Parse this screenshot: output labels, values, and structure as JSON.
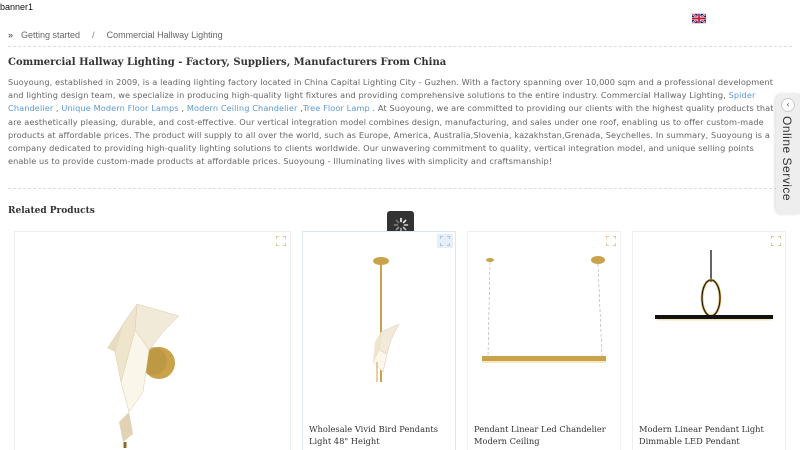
{
  "banner": {
    "label": "banner1"
  },
  "header": {
    "flag_icon": "uk-flag-icon"
  },
  "breadcrumb": {
    "items": [
      "Getting started",
      "Commercial Hallway Lighting"
    ],
    "separator": "/"
  },
  "page": {
    "title": "Commercial Hallway Lighting - Factory, Suppliers, Manufacturers From China",
    "intro": {
      "p1": "Suoyoung, established in 2009, is a leading lighting factory located in China Capital Lighting City - Guzhen. With a factory spanning over 10,000 sqm and a professional development and lighting design team, we specialize in producing high-quality light fixtures and providing comprehensive solutions to the entire industry. Commercial Hallway Lighting, ",
      "link1": "Spider Chandelier",
      "sep1": " , ",
      "link2": "Unique Modern Floor Lamps",
      "sep2": " , ",
      "link3": "Modern Ceiling Chandelier",
      "sep3": " ,",
      "link4": "Tree Floor Lamp",
      "p2": " . At Suoyoung, we are committed to providing our clients with the highest quality products that are aesthetically pleasing, durable, and cost-effective. Our vertical integration model combines design, manufacturing, and sales under one roof, enabling us to offer custom-made products at affordable prices. The product will supply to all over the world, such as Europe, America, Australia,Slovenia, kazakhstan,Grenada, Seychelles. In summary, Suoyoung is a company dedicated to providing high-quality lighting solutions to clients worldwide. Our unwavering commitment to quality, vertical integration model, and unique selling points enable us to provide custom-made products at affordable prices. Suoyoung - Illuminating lives with simplicity and craftsmanship!"
    }
  },
  "related": {
    "heading": "Related Products",
    "products": [
      {
        "title": ""
      },
      {
        "title": "Wholesale Vivid Bird Pendants Light 48\" Height"
      },
      {
        "title": "Pendant Linear Led Chandelier Modern Ceiling"
      },
      {
        "title": "Modern Linear Pendant Light Dimmable LED Pendant"
      }
    ]
  },
  "online_service": {
    "label": "Online Service"
  },
  "colors": {
    "link": "#5b9bd5",
    "brass": "#c9a24a",
    "loader_bg": "#333333"
  }
}
